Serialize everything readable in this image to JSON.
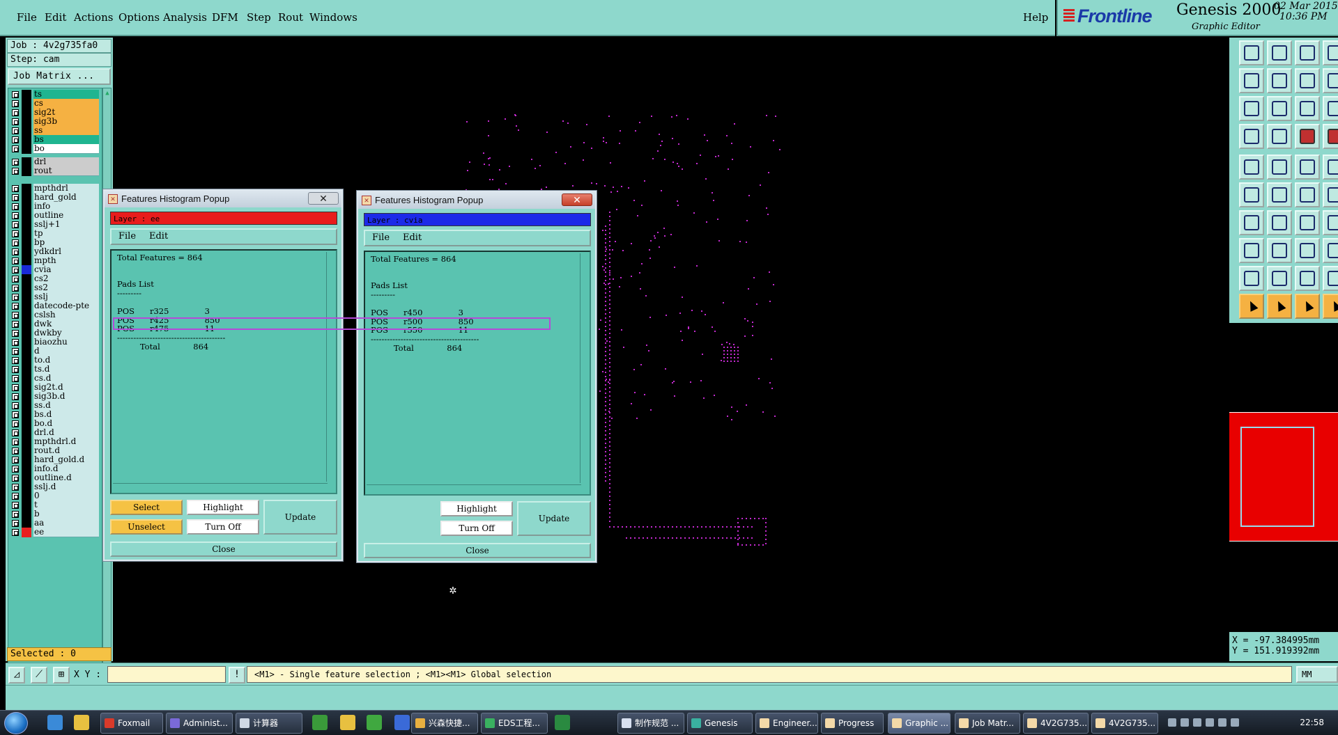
{
  "menubar": {
    "items": [
      {
        "label": "File",
        "ul": "F"
      },
      {
        "label": "Edit",
        "ul": "E"
      },
      {
        "label": "Actions",
        "ul": "A"
      },
      {
        "label": "Options",
        "ul": "O"
      },
      {
        "label": "Analysis",
        "ul": "A"
      },
      {
        "label": "DFM",
        "ul": "D"
      },
      {
        "label": "Step",
        "ul": "S"
      },
      {
        "label": "Rout",
        "ul": "R"
      },
      {
        "label": "Windows",
        "ul": "W"
      }
    ],
    "help": "Help"
  },
  "brand": {
    "logo": "Frontline",
    "product": "Genesis 2000",
    "subtitle": "Graphic Editor",
    "date": "02 Mar 2015",
    "time": "10:36 PM"
  },
  "leftpanel": {
    "job": "Job : 4v2g735fa0",
    "step": "Step: cam",
    "job_matrix_button": "Job Matrix ...",
    "selected": "Selected : 0",
    "layers": [
      {
        "name": "ts",
        "color": "#1fb590"
      },
      {
        "name": "cs",
        "color": "#f5b142"
      },
      {
        "name": "sig2t",
        "color": "#f5b142"
      },
      {
        "name": "sig3b",
        "color": "#f5b142"
      },
      {
        "name": "ss",
        "color": "#f5b142"
      },
      {
        "name": "bs",
        "color": "#1fb590"
      },
      {
        "name": "bo",
        "color": "#ffffff"
      },
      {
        "name": "drl",
        "color": "#cccccc"
      },
      {
        "name": "rout",
        "color": "#cccccc"
      },
      {
        "name": "mpthdrl",
        "color": "#cde9e9"
      },
      {
        "name": "hard_gold",
        "color": "#cde9e9"
      },
      {
        "name": "info",
        "color": "#cde9e9"
      },
      {
        "name": "outline",
        "color": "#cde9e9"
      },
      {
        "name": "sslj+1",
        "color": "#cde9e9"
      },
      {
        "name": "tp",
        "color": "#cde9e9"
      },
      {
        "name": "bp",
        "color": "#cde9e9"
      },
      {
        "name": "ydkdrl",
        "color": "#cde9e9"
      },
      {
        "name": "mpth",
        "color": "#cde9e9"
      },
      {
        "name": "cvia",
        "color": "#cde9e9",
        "swatch": "#1a2ad8"
      },
      {
        "name": "cs2",
        "color": "#cde9e9"
      },
      {
        "name": "ss2",
        "color": "#cde9e9"
      },
      {
        "name": "sslj",
        "color": "#cde9e9"
      },
      {
        "name": "datecode-pte",
        "color": "#cde9e9"
      },
      {
        "name": "cslsh",
        "color": "#cde9e9"
      },
      {
        "name": "dwk",
        "color": "#cde9e9"
      },
      {
        "name": "dwkby",
        "color": "#cde9e9"
      },
      {
        "name": "biaozhu",
        "color": "#cde9e9"
      },
      {
        "name": "d",
        "color": "#cde9e9"
      },
      {
        "name": "to.d",
        "color": "#cde9e9"
      },
      {
        "name": "ts.d",
        "color": "#cde9e9"
      },
      {
        "name": "cs.d",
        "color": "#cde9e9"
      },
      {
        "name": "sig2t.d",
        "color": "#cde9e9"
      },
      {
        "name": "sig3b.d",
        "color": "#cde9e9"
      },
      {
        "name": "ss.d",
        "color": "#cde9e9"
      },
      {
        "name": "bs.d",
        "color": "#cde9e9"
      },
      {
        "name": "bo.d",
        "color": "#cde9e9"
      },
      {
        "name": "drl.d",
        "color": "#cde9e9"
      },
      {
        "name": "mpthdrl.d",
        "color": "#cde9e9"
      },
      {
        "name": "rout.d",
        "color": "#cde9e9"
      },
      {
        "name": "hard_gold.d",
        "color": "#cde9e9"
      },
      {
        "name": "info.d",
        "color": "#cde9e9"
      },
      {
        "name": "outline.d",
        "color": "#cde9e9"
      },
      {
        "name": "sslj.d",
        "color": "#cde9e9"
      },
      {
        "name": "0",
        "color": "#cde9e9"
      },
      {
        "name": "t",
        "color": "#cde9e9"
      },
      {
        "name": "b",
        "color": "#cde9e9"
      },
      {
        "name": "aa",
        "color": "#cde9e9"
      },
      {
        "name": "ee",
        "color": "#cde9e9",
        "swatch": "#e82020"
      }
    ]
  },
  "popup_left": {
    "title": "Features Histogram Popup",
    "layer": "Layer :  ee",
    "layer_color": "#e81c1c",
    "menu": [
      "File",
      "Edit"
    ],
    "text": "Total Features = 864\n\n\nPads List\n---------\n\nPOS      r325              3\nPOS      r425              850\nPOS      r475              11\n----------------------------------------\n         Total             864",
    "buttons": {
      "select": "Select",
      "unselect": "Unselect",
      "highlight": "Highlight",
      "turn_off": "Turn Off",
      "update": "Update",
      "close": "Close"
    },
    "close_glyph": "✕"
  },
  "popup_right": {
    "title": "Features Histogram Popup",
    "layer": "Layer :  cvia",
    "layer_color": "#1c2ae8",
    "menu": [
      "File",
      "Edit"
    ],
    "text": "Total Features = 864\n\n\nPads List\n---------\n\nPOS      r450              3\nPOS      r500              850\nPOS      r550              11\n----------------------------------------\n         Total             864",
    "buttons": {
      "highlight": "Highlight",
      "turn_off": "Turn Off",
      "update": "Update",
      "close": "Close"
    },
    "close_glyph": "✕"
  },
  "coords": {
    "x": "X = -97.384995mm",
    "y": "Y = 151.919392mm"
  },
  "cmdbar": {
    "xy_label": "X Y :",
    "xy_value": "",
    "prompt": "<M1> - Single feature selection ; <M1><M1> Global selection",
    "units": "MM"
  },
  "taskbar": {
    "tasks": [
      {
        "label": "Foxmail",
        "icon_color": "#d83a2a"
      },
      {
        "label": "Administ...",
        "icon_color": "#7a6ad8"
      },
      {
        "label": "计算器",
        "icon_color": "#cfd8e4"
      },
      {
        "label": "兴森快捷...",
        "icon_color": "#e8b040"
      },
      {
        "label": "EDS工程...",
        "icon_color": "#3ab060"
      },
      {
        "label": "制作规范 ...",
        "icon_color": "#d8e0f0"
      },
      {
        "label": "Genesis",
        "icon_color": "#3ab0a0"
      },
      {
        "label": "Engineer...",
        "icon_color": "#f3d9a8"
      },
      {
        "label": "Progress",
        "icon_color": "#f3d9a8"
      },
      {
        "label": "Graphic ...",
        "icon_color": "#f3d9a8"
      },
      {
        "label": "Job Matr...",
        "icon_color": "#f3d9a8"
      },
      {
        "label": "4V2G735...",
        "icon_color": "#f3d9a8"
      },
      {
        "label": "4V2G735...",
        "icon_color": "#f3d9a8"
      }
    ],
    "clock": "22:58"
  }
}
